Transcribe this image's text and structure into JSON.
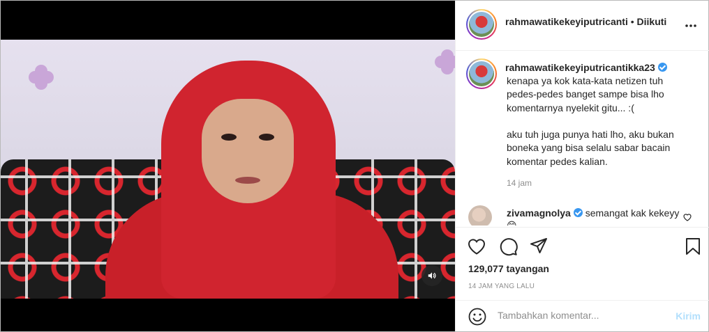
{
  "post": {
    "username": "rahmawatikekeyiputricanti",
    "separator": "•",
    "follow_status": "Diikuti"
  },
  "caption": {
    "username": "rahmawatikekeyiputricantikka23",
    "text": "kenapa ya kok kata-kata netizen tuh\npedes-pedes banget sampe bisa lho\nkomentarnya nyelekit gitu... :(\n\naku tuh juga punya hati lho, aku bukan\nboneka yang bisa selalu sabar bacain\nkomentar pedes kalian.",
    "time": "14 jam"
  },
  "comments": [
    {
      "username": "zivamagnolya",
      "text": "semangat kak kekeyy😊"
    }
  ],
  "stats": {
    "views": "129,077 tayangan",
    "posted": "14 JAM YANG LALU"
  },
  "add_comment": {
    "placeholder": "Tambahkan komentar...",
    "post_label": "Kirim"
  },
  "icons": {
    "like": "heart-icon",
    "comment": "comment-bubble-icon",
    "share": "paper-plane-icon",
    "save": "bookmark-icon",
    "more": "more-dots-icon",
    "volume": "speaker-icon",
    "emoji": "smiley-icon"
  },
  "colors": {
    "verified": "#3897f0",
    "post_button_disabled": "#b2dffc",
    "secondary_text": "#8e8e8e"
  }
}
